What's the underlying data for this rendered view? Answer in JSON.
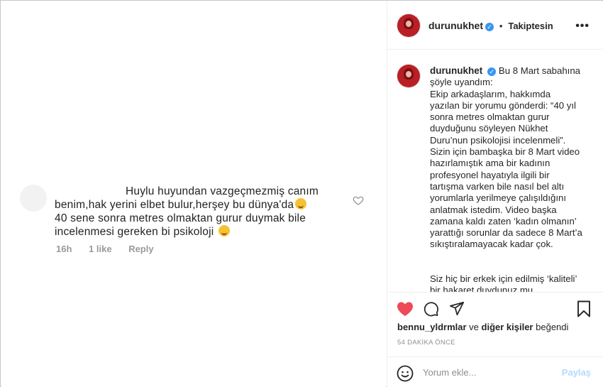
{
  "post": {
    "comment": {
      "lines": [
        "Huylu huyundan vazgeçmezmiş canım",
        "benim,hak yerini elbet bulur,herşey bu dünya'da",
        "40 sene sonra metres olmaktan gurur duymak bile",
        "incelenmesi gereken bi psikoloji"
      ],
      "time": "16h",
      "likes": "1 like",
      "reply": "Reply"
    }
  },
  "header": {
    "username": "durunukhet",
    "separator": "•",
    "follow_status": "Takiptesin",
    "more": "•••"
  },
  "caption": {
    "username": "durunukhet",
    "paragraph1": "Bu 8 Mart sabahına şöyle uyandım:",
    "paragraph2": "Ekip arkadaşlarım, hakkımda yazılan bir yorumu gönderdi: “40 yıl sonra metres olmaktan gurur duyduğunu söyleyen Nükhet Duru’nun psikolojisi incelenmeli”. Sizin için bambaşka bir 8 Mart video hazırlamıştık ama bir kadının profesyonel hayatıyla ilgili bir tartışma varken bile nasıl bel altı yorumlarla yerilmeye çalışıldığını anlatmak istedim. Video başka zamana kaldı zaten ‘kadın olmanın’ yarattığı sorunlar da sadece 8 Mart’a sıkıştıralamayacak kadar çok.",
    "paragraph3": "Siz hiç bir erkek için edilmiş ‘kaliteli’ bir hakaret duydunuz mu ömrünüzde? Hakaretin kendisi bile 15 kere sorgulanmalıyken, ‘bir metreslik"
  },
  "actions": {
    "liked_by_prefix": "",
    "liked_by_user": "bennu_yldrmlar",
    "liked_by_and": "ve",
    "liked_by_others": "diğer kişiler",
    "liked_by_suffix": "beğendi",
    "timestamp": "54 DAKİKA ÖNCE"
  },
  "comment_input": {
    "placeholder": "Yorum ekle...",
    "post_label": "Paylaş"
  },
  "colors": {
    "heart": "#ed4956",
    "verified": "#3897f0",
    "post_disabled": "#b3dbff"
  }
}
